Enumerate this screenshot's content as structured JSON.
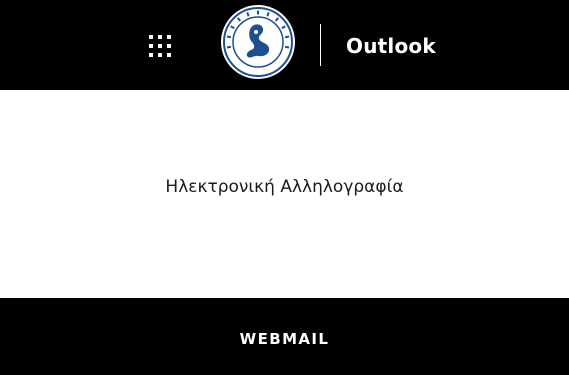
{
  "header": {
    "app_launcher_icon": "app-launcher-grid-icon",
    "logo_icon": "university-seal-logo",
    "app_name": "Outlook"
  },
  "main": {
    "title": "Ηλεκτρονική Αλληλογραφία"
  },
  "footer": {
    "webmail_label": "WEBMAIL"
  },
  "colors": {
    "bar_background": "#000000",
    "page_background": "#ffffff",
    "bar_text": "#ffffff",
    "body_text": "#1b1b1b",
    "seal_blue": "#1f4f8f"
  }
}
